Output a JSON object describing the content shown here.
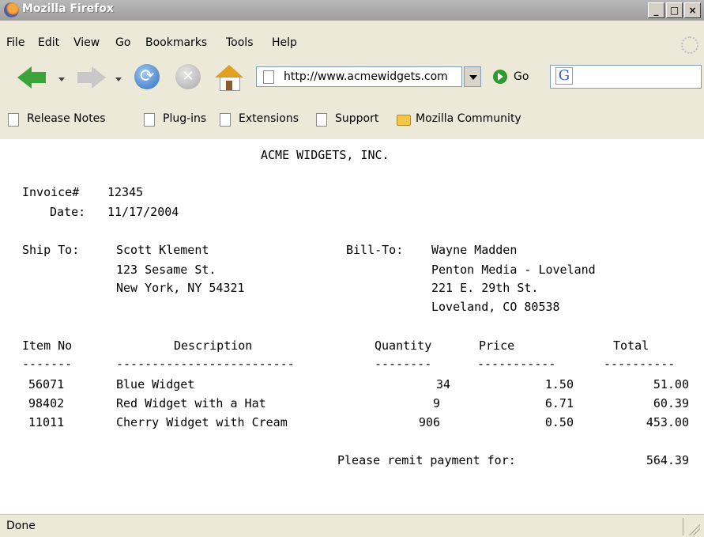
{
  "window": {
    "title": "Mozilla Firefox",
    "min_glyph": "_",
    "max_glyph": "□",
    "close_glyph": "×"
  },
  "menu": {
    "items": [
      "File",
      "Edit",
      "View",
      "Go",
      "Bookmarks",
      "Tools",
      "Help"
    ]
  },
  "toolbar": {
    "url": "http://www.acmewidgets.com",
    "go_label": "Go",
    "search_value": "",
    "search_engine_icon": "G"
  },
  "bookmarks": {
    "items": [
      "Release Notes",
      "Plug-ins",
      "Extensions",
      "Support",
      "Mozilla Community"
    ]
  },
  "invoice": {
    "company": "ACME WIDGETS, INC.",
    "invoice_label": "Invoice#",
    "invoice_no": "12345",
    "date_label": "Date:",
    "date": "11/17/2004",
    "ship_to_label": "Ship To:",
    "ship_to": [
      "Scott Klement",
      "123 Sesame St.",
      "New York, NY 54321"
    ],
    "bill_to_label": "Bill-To:",
    "bill_to": [
      "Wayne Madden",
      "Penton Media - Loveland",
      "221 E. 29th St.",
      "Loveland, CO 80538"
    ],
    "headers": {
      "item_no": "Item No",
      "description": "Description",
      "quantity": "Quantity",
      "price": "Price",
      "total": "Total"
    },
    "separators": {
      "item_no": "-------",
      "description": "-------------------------",
      "quantity": "--------",
      "price": "-----------",
      "total": "----------"
    },
    "lines": [
      {
        "item_no": "56071",
        "description": "Blue Widget",
        "quantity": "34",
        "price": "1.50",
        "total": "51.00"
      },
      {
        "item_no": "98402",
        "description": "Red Widget with a Hat",
        "quantity": "9",
        "price": "6.71",
        "total": "60.39"
      },
      {
        "item_no": "11011",
        "description": "Cherry Widget with Cream",
        "quantity": "906",
        "price": "0.50",
        "total": "453.00"
      }
    ],
    "remit_label": "Please remit payment for:",
    "remit_total": "564.39"
  },
  "status": {
    "text": "Done"
  }
}
